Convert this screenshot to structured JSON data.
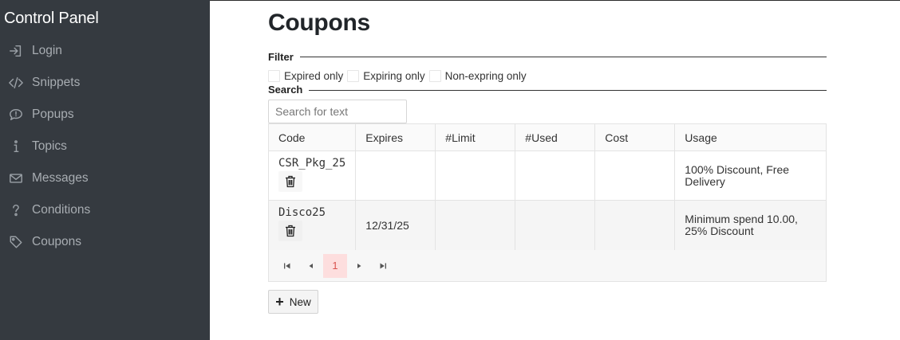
{
  "sidebar": {
    "brand": "Control Panel",
    "items": [
      {
        "label": "Login",
        "icon": "login-icon"
      },
      {
        "label": "Snippets",
        "icon": "code-icon"
      },
      {
        "label": "Popups",
        "icon": "speech-bubble-icon"
      },
      {
        "label": "Topics",
        "icon": "info-icon"
      },
      {
        "label": "Messages",
        "icon": "envelope-icon"
      },
      {
        "label": "Conditions",
        "icon": "question-icon"
      },
      {
        "label": "Coupons",
        "icon": "tag-icon"
      }
    ]
  },
  "main": {
    "title": "Coupons",
    "filter_legend": "Filter",
    "filters": [
      "Expired only",
      "Expiring only",
      "Non-expring only"
    ],
    "search_legend": "Search",
    "search_placeholder": "Search for text",
    "columns": [
      "Code",
      "Expires",
      "#Limit",
      "#Used",
      "Cost",
      "Usage"
    ],
    "rows": [
      {
        "code": "CSR_Pkg_25",
        "expires": "",
        "limit": "",
        "used": "",
        "cost": "",
        "usage": "100% Discount, Free Delivery"
      },
      {
        "code": "Disco25",
        "expires": "12/31/25",
        "limit": "",
        "used": "",
        "cost": "",
        "usage": "Minimum spend 10.00, 25% Discount"
      }
    ],
    "pagination": {
      "current_page": "1"
    },
    "new_button": "New"
  },
  "colors": {
    "sidebar_bg": "#353a40",
    "active_page_bg": "#fddede",
    "active_page_text": "#d9534f"
  }
}
